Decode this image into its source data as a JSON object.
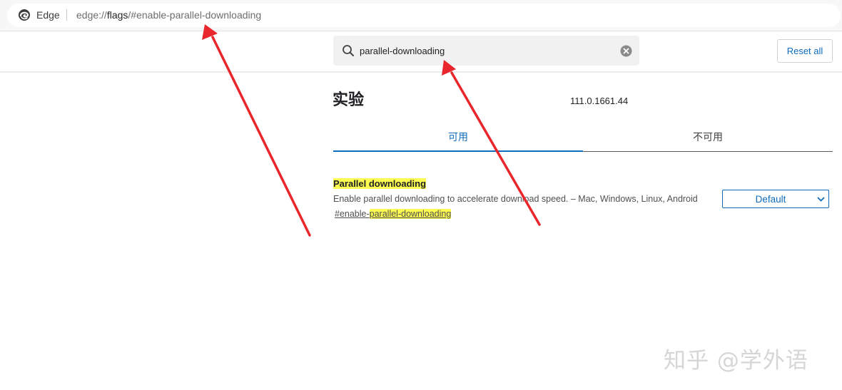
{
  "browser": {
    "brand": "Edge",
    "url_prefix": "edge://",
    "url_highlight": "flags",
    "url_suffix": "/#enable-parallel-downloading"
  },
  "header": {
    "search_value": "parallel-downloading",
    "reset_label": "Reset all"
  },
  "page": {
    "title": "实验",
    "version": "111.0.1661.44"
  },
  "tabs": [
    {
      "label": "可用",
      "active": true
    },
    {
      "label": "不可用",
      "active": false
    }
  ],
  "flag": {
    "name": "Parallel downloading",
    "description": "Enable parallel downloading to accelerate download speed. – Mac, Windows, Linux, Android",
    "link_prefix": "#enable-",
    "link_highlight": "parallel-downloading",
    "selected_option": "Default"
  },
  "watermark": "知乎 @学外语",
  "colors": {
    "accent": "#0f6cbd",
    "highlight": "#fbfb51",
    "arrow": "#e8262b"
  }
}
